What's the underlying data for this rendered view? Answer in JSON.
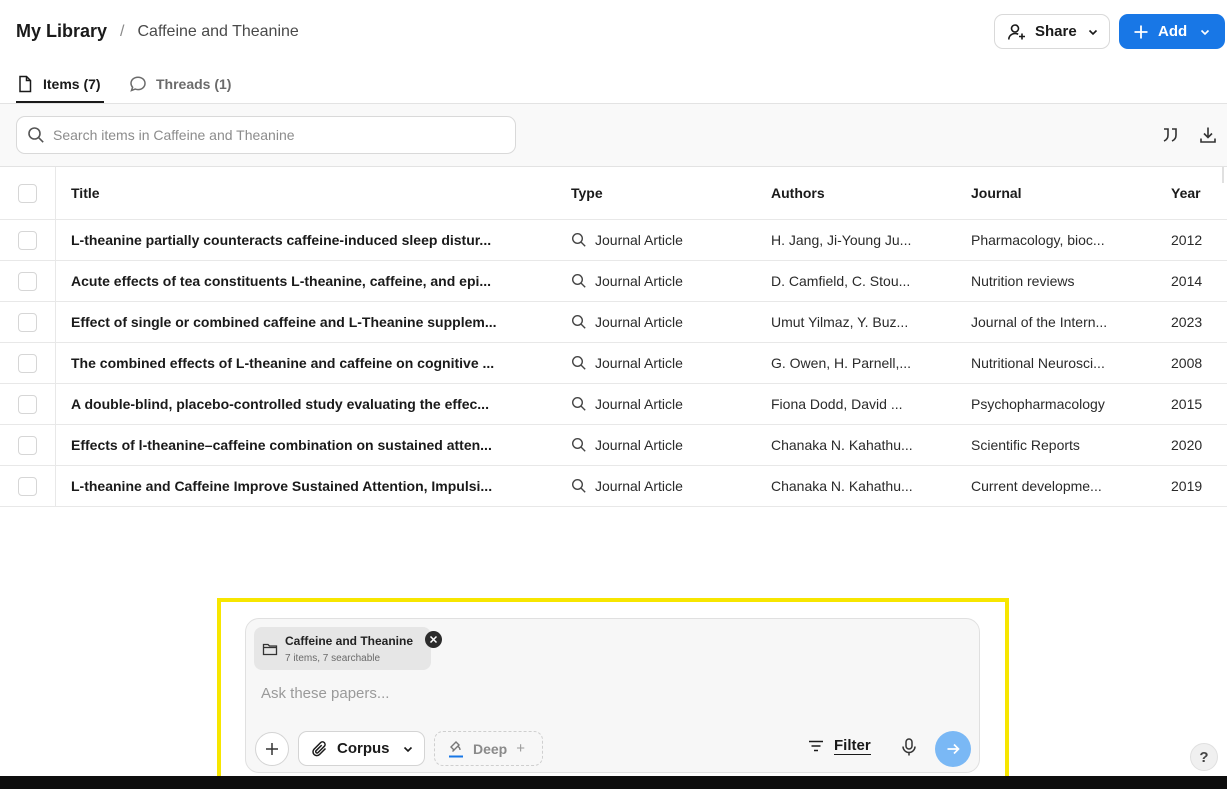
{
  "breadcrumb": {
    "root": "My Library",
    "separator": "/",
    "current": "Caffeine and Theanine"
  },
  "header": {
    "share_label": "Share",
    "add_label": "Add"
  },
  "tabs": [
    {
      "label": "Items (7)",
      "icon": "document-icon",
      "active": true
    },
    {
      "label": "Threads (1)",
      "icon": "chat-bubble-icon",
      "active": false
    }
  ],
  "search": {
    "placeholder": "Search items in Caffeine and Theanine",
    "value": ""
  },
  "toolbar": {
    "icons": [
      "quote-icon",
      "download-icon"
    ]
  },
  "table": {
    "columns": [
      "Title",
      "Type",
      "Authors",
      "Journal",
      "Year"
    ],
    "rows": [
      {
        "title": "L-theanine partially counteracts caffeine-induced sleep distur...",
        "type": "Journal Article",
        "authors": "H. Jang, Ji-Young Ju...",
        "journal": "Pharmacology, bioc...",
        "year": "2012"
      },
      {
        "title": "Acute effects of tea constituents L-theanine, caffeine, and epi...",
        "type": "Journal Article",
        "authors": "D. Camfield, C. Stou...",
        "journal": "Nutrition reviews",
        "year": "2014"
      },
      {
        "title": "Effect of single or combined caffeine and L-Theanine supplem...",
        "type": "Journal Article",
        "authors": "Umut Yilmaz, Y. Buz...",
        "journal": "Journal of the Intern...",
        "year": "2023"
      },
      {
        "title": "The combined effects of L-theanine and caffeine on cognitive ...",
        "type": "Journal Article",
        "authors": "G. Owen, H. Parnell,...",
        "journal": "Nutritional Neurosci...",
        "year": "2008"
      },
      {
        "title": "A double-blind, placebo-controlled study evaluating the effec...",
        "type": "Journal Article",
        "authors": "Fiona Dodd, David ...",
        "journal": "Psychopharmacology",
        "year": "2015"
      },
      {
        "title": "Effects of l-theanine–caffeine combination on sustained atten...",
        "type": "Journal Article",
        "authors": "Chanaka N. Kahathu...",
        "journal": "Scientific Reports",
        "year": "2020"
      },
      {
        "title": "L-theanine and Caffeine Improve Sustained Attention, Impulsi...",
        "type": "Journal Article",
        "authors": "Chanaka N. Kahathu...",
        "journal": "Current developme...",
        "year": "2019"
      }
    ]
  },
  "composer": {
    "chip_title": "Caffeine and Theanine",
    "chip_subtitle": "7 items, 7 searchable",
    "placeholder": "Ask these papers...",
    "corpus_label": "Corpus",
    "deep_label": "Deep",
    "filter_label": "Filter"
  },
  "help_label": "?",
  "colors": {
    "accent": "#1877e6",
    "send": "#7ab8f5",
    "highlight": "#f7e600"
  }
}
